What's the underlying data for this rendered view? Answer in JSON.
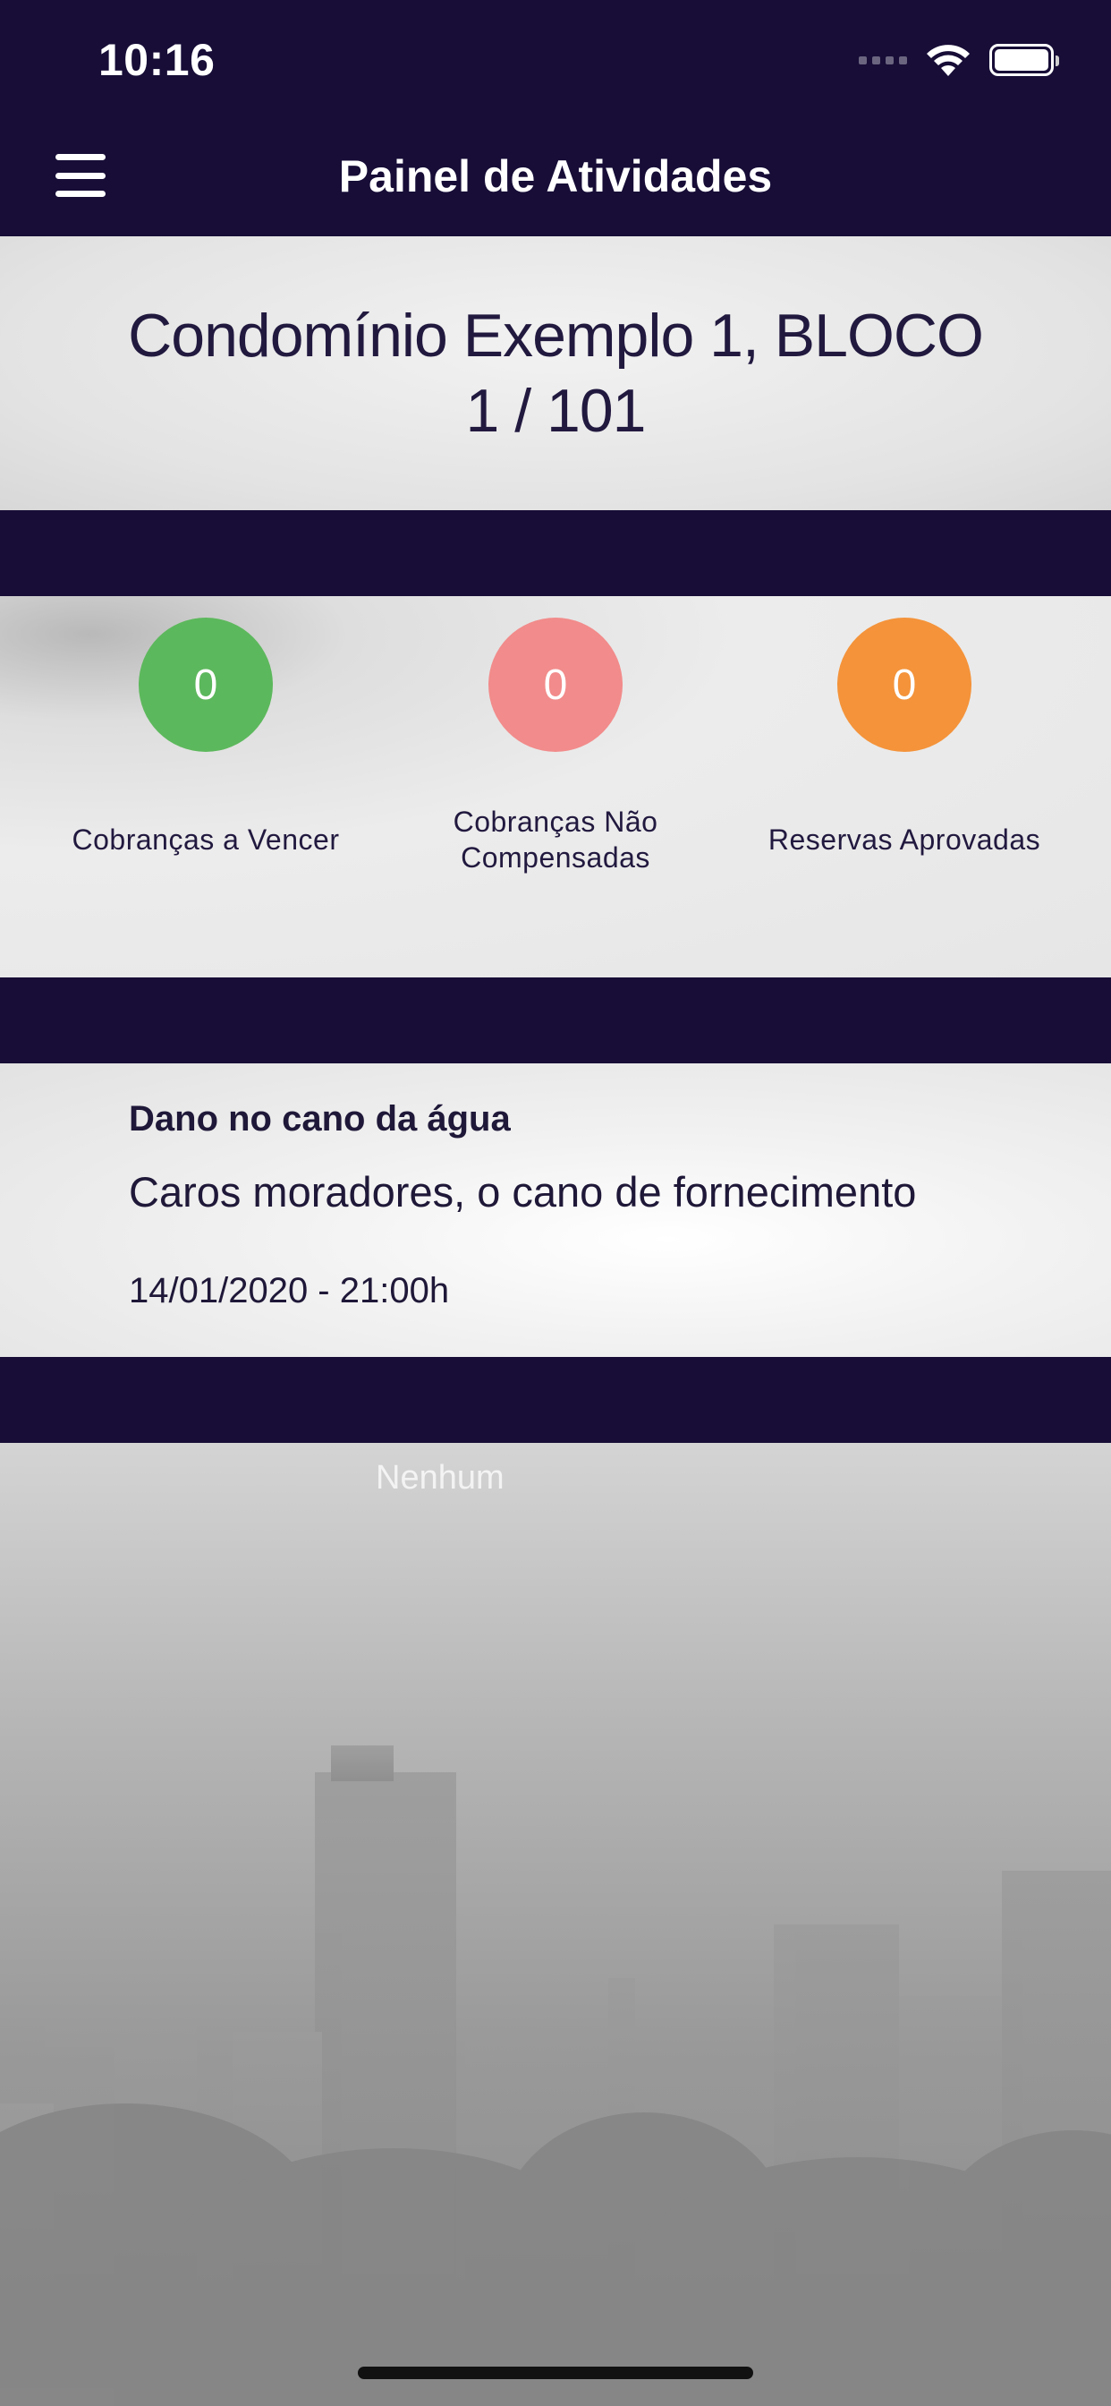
{
  "status_bar": {
    "time": "10:16"
  },
  "nav": {
    "title": "Painel de Atividades"
  },
  "condo": {
    "name": "Condomínio Exemplo 1, BLOCO 1 / 101"
  },
  "indicators": [
    {
      "count": "0",
      "label": "Cobranças a Vencer",
      "color": "#5cb85c"
    },
    {
      "count": "0",
      "label": "Cobranças Não Compensadas",
      "color": "#f28b8b"
    },
    {
      "count": "0",
      "label": "Reservas Aprovadas",
      "color": "#f4933a"
    }
  ],
  "notice": {
    "title": "Dano no cano da água",
    "body": "Caros moradores, o cano de fornecimento",
    "date": "14/01/2020 - 21:00h"
  },
  "empty_state": {
    "text": "Nenhum"
  }
}
